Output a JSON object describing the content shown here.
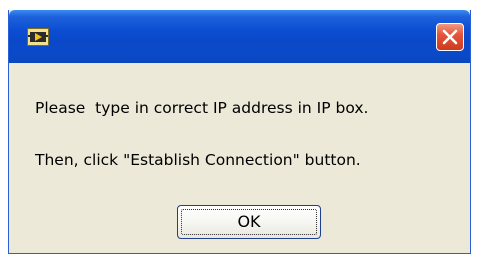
{
  "dialog": {
    "title_icon": "labview-app-icon",
    "close_icon": "close-icon",
    "message_line_1": "Please  type in correct IP address in IP box.",
    "message_line_2": "Then, click \"Establish Connection\" button.",
    "ok_label": "OK"
  },
  "colors": {
    "titlebar": "#0a48c8",
    "close_button": "#e4553b",
    "dialog_body": "#ece9d8"
  }
}
